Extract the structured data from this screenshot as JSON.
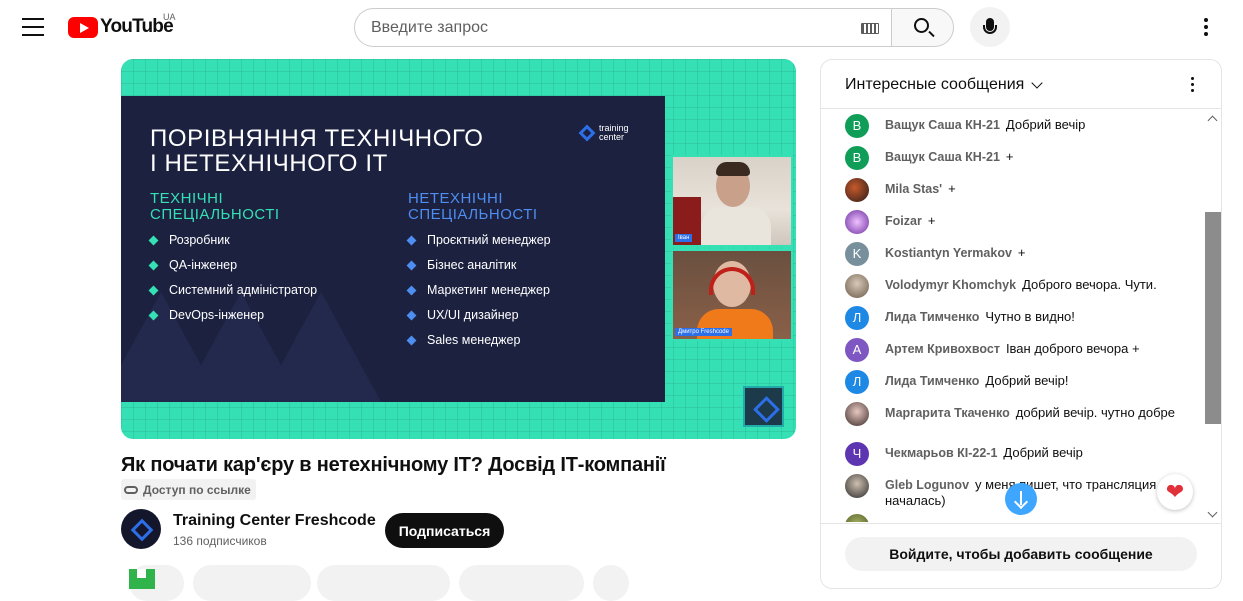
{
  "header": {
    "logo_text": "YouTube",
    "country_code": "UA",
    "search_placeholder": "Введите запрос",
    "icons": [
      "menu-icon",
      "keyboard-icon",
      "search-icon",
      "microphone-icon",
      "more-vert-icon"
    ]
  },
  "video": {
    "slide": {
      "title_line1": "ПОРІВНЯННЯ ТЕХНІЧНОГО",
      "title_line2": "І НЕТЕХНІЧНОГО ІТ",
      "logo_line1": "training",
      "logo_line2": "center",
      "tech_head_line1": "ТЕХНІЧНІ",
      "tech_head_line2": "СПЕЦІАЛЬНОСТІ",
      "tech_items": [
        "Розробник",
        "QA-інженер",
        "Системний адміністратор",
        "DevOps-інженер"
      ],
      "nontech_head_line1": "НЕТЕХНІЧНІ",
      "nontech_head_line2": "СПЕЦІАЛЬНОСТІ",
      "nontech_items": [
        "Проєктний менеджер",
        "Бізнес аналітик",
        "Маркетинг менеджер",
        "UX/UI дизайнер",
        "Sales менеджер"
      ],
      "cam1_name": "Іван",
      "cam2_name": "Дмитро Freshcode"
    },
    "title": "Як почати кар'єру в нетехнічному ІТ? Досвід ІТ-компанії",
    "access_badge": "Доступ по ссылке",
    "channel": {
      "name": "Training Center Freshcode",
      "subscribers": "136 подписчиков",
      "subscribe_label": "Подписаться"
    }
  },
  "chat": {
    "title": "Интересные сообщения",
    "signin_label": "Войдите, чтобы добавить сообщение",
    "messages": [
      {
        "initial": "В",
        "color": "#0f9d58",
        "author": "Ващук Саша КН-21",
        "text": "Добрий вечір"
      },
      {
        "initial": "В",
        "color": "#0f9d58",
        "author": "Ващук Саша КН-21",
        "text": "+"
      },
      {
        "initial": "",
        "color": "#3a2a2a",
        "author": "Mila Stas'",
        "text": "+"
      },
      {
        "initial": "",
        "color": "#6b2fa0",
        "author": "Foizar",
        "text": "+"
      },
      {
        "initial": "K",
        "color": "#78909c",
        "author": "Kostiantyn Yermakov",
        "text": "+"
      },
      {
        "initial": "",
        "color": "#8a7a6a",
        "author": "Volodymyr Khomchyk",
        "text": "Доброго вечора. Чути."
      },
      {
        "initial": "Л",
        "color": "#1e88e5",
        "author": "Лида Тимченко",
        "text": "Чутно в видно!"
      },
      {
        "initial": "А",
        "color": "#7e57c2",
        "author": "Артем Кривохвост",
        "text": "Іван доброго вечора +"
      },
      {
        "initial": "Л",
        "color": "#1e88e5",
        "author": "Лида Тимченко",
        "text": "Добрий вечір!"
      },
      {
        "initial": "",
        "color": "#4a3a3a",
        "author": "Маргарита Ткаченко",
        "text": "добрий вечір. чутно добре"
      },
      {
        "initial": "Ч",
        "color": "#5e35b1",
        "author": "Чекмарьов КІ-22-1",
        "text": "Добрий вечір"
      },
      {
        "initial": "",
        "color": "#2a2a2a",
        "author": "Gleb Logunov",
        "text": "у меня пишет, что трансляция не началась)"
      }
    ]
  }
}
